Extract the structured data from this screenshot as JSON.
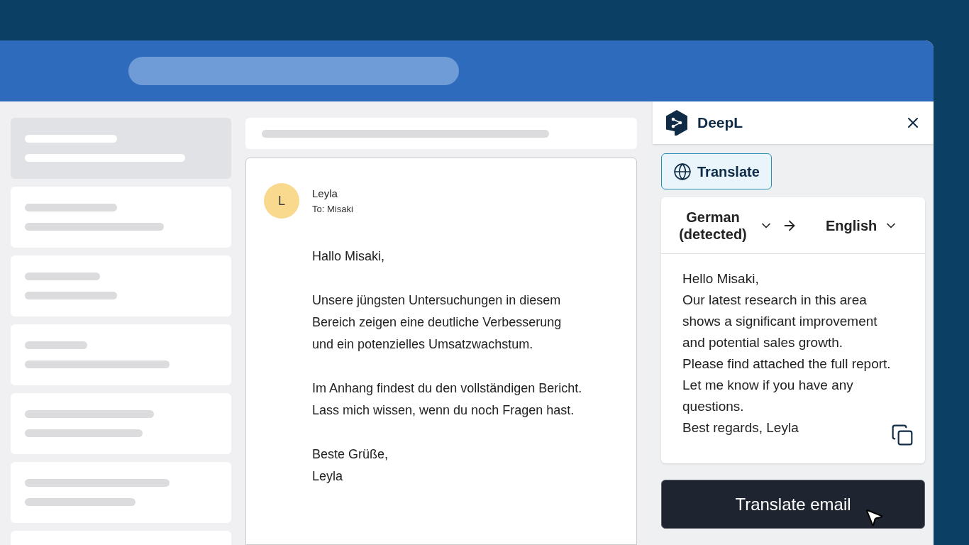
{
  "mail_list": [
    {
      "selected": true
    },
    {
      "selected": false
    },
    {
      "selected": false
    },
    {
      "selected": false
    },
    {
      "selected": false
    },
    {
      "selected": false
    },
    {
      "selected": false
    }
  ],
  "email": {
    "avatar_letter": "L",
    "sender": "Leyla",
    "recipient": "To: Misaki",
    "paragraphs": [
      [
        "Hallo Misaki,"
      ],
      [
        "Unsere jüngsten Untersuchungen in diesem",
        "Bereich zeigen eine deutliche Verbesserung",
        "und ein potenzielles Umsatzwachstum."
      ],
      [
        "Im Anhang findest du den vollständigen Bericht.",
        "Lass mich wissen, wenn du noch Fragen hast."
      ],
      [
        "Beste Grüße,",
        "Leyla"
      ]
    ]
  },
  "panel": {
    "brand": "DeepL",
    "tabs": [
      {
        "label": "Translate",
        "selected": true
      }
    ],
    "source_language": "German (detected)",
    "target_language": "English",
    "translation": [
      "Hello Misaki,",
      "Our latest research in this area",
      "shows a significant improvement",
      "and potential sales growth.",
      "Please find attached the full report.",
      "Let me know if you have any",
      "questions.",
      "Best regards, Leyla"
    ],
    "action_button": "Translate email"
  }
}
